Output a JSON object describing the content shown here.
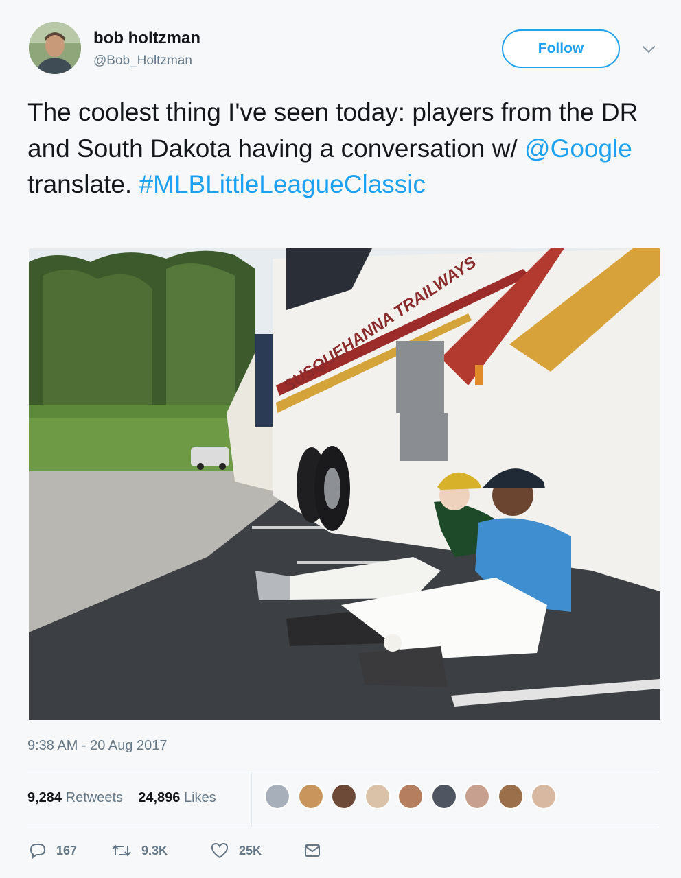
{
  "author": {
    "name": "bob holtzman",
    "handle": "@Bob_Holtzman"
  },
  "follow_label": "Follow",
  "tweet": {
    "text_before": "The coolest thing I've seen today: players from the DR and South Dakota having a conversation w/ ",
    "mention": "@Google",
    "text_after": " translate. ",
    "hashtag": "#MLBLittleLeagueClassic"
  },
  "photo": {
    "bus_lettering": "SUSQUEHANNA TRAILWAYS"
  },
  "timestamp": "9:38 AM - 20 Aug 2017",
  "stats": {
    "retweets_count": "9,284",
    "retweets_label": "Retweets",
    "likes_count": "24,896",
    "likes_label": "Likes"
  },
  "actions": {
    "reply_count": "167",
    "retweet_count": "9.3K",
    "like_count": "25K"
  },
  "colors": {
    "accent": "#1da1f2",
    "secondary_text": "#657786",
    "background": "#f7f8f9"
  },
  "icons": [
    "chevron-down-icon",
    "reply-icon",
    "retweet-icon",
    "heart-icon",
    "message-icon"
  ]
}
